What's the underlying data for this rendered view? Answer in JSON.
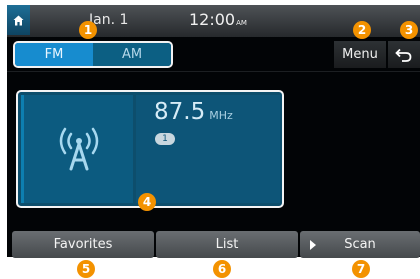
{
  "status_bar": {
    "date": "Jan.  1",
    "time": "12:00",
    "ampm": "AM"
  },
  "band_toggle": {
    "fm_label": "FM",
    "am_label": "AM",
    "selected": "FM"
  },
  "header_buttons": {
    "menu_label": "Menu"
  },
  "station": {
    "frequency": "87.5",
    "unit": "MHz",
    "preset_number": "1"
  },
  "bottom_buttons": {
    "favorites_label": "Favorites",
    "list_label": "List",
    "scan_label": "Scan"
  },
  "callouts": [
    "1",
    "2",
    "3",
    "4",
    "5",
    "6",
    "7"
  ],
  "colors": {
    "accent_blue": "#178ccf",
    "card_blue": "#0d5578",
    "callout_orange": "#f39200"
  },
  "icons": {
    "home": "home-icon",
    "back": "back-arrow-icon",
    "antenna": "radio-antenna-icon",
    "scan": "play-icon"
  }
}
